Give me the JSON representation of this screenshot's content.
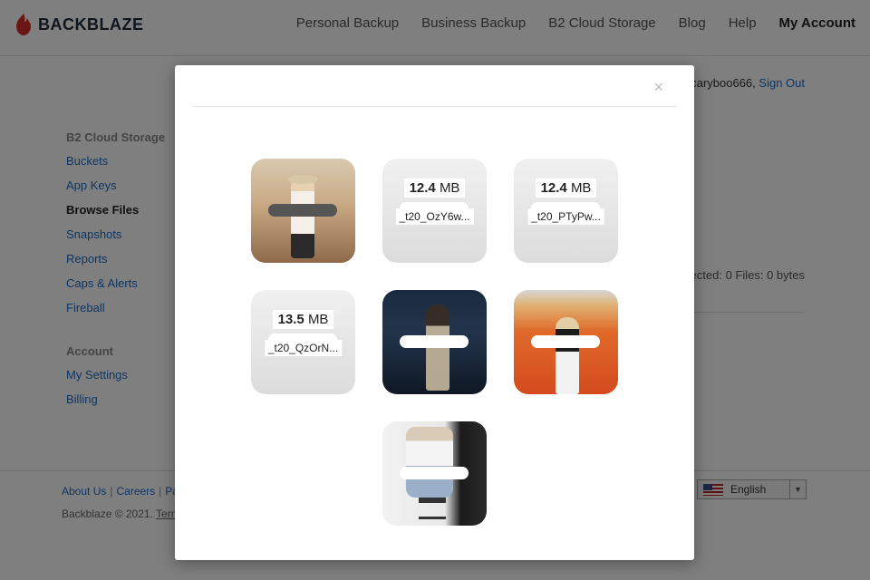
{
  "header": {
    "logo_text": "BACKBLAZE",
    "nav": [
      "Personal Backup",
      "Business Backup",
      "B2 Cloud Storage",
      "Blog",
      "Help",
      "My Account"
    ]
  },
  "user": {
    "name": "caryboo666,",
    "sign_out": "Sign Out"
  },
  "sidebar": {
    "group1_title": "B2 Cloud Storage",
    "items": [
      "Buckets",
      "App Keys",
      "Browse Files",
      "Snapshots",
      "Reports",
      "Caps & Alerts",
      "Fireball"
    ],
    "group2_title": "Account",
    "items2": [
      "My Settings",
      "Billing"
    ]
  },
  "stats_text": "ected: 0 Files: 0 bytes",
  "footer": {
    "links": [
      "About Us",
      "Careers",
      "Pa"
    ],
    "copyright": "Backblaze © 2021.",
    "terms": "Term",
    "language": "English"
  },
  "modal": {
    "close_label": "×",
    "tiles": [
      {
        "kind": "photo"
      },
      {
        "kind": "file",
        "size_value": "12.4",
        "size_unit": "MB",
        "name": "_t20_OzY6w..."
      },
      {
        "kind": "file",
        "size_value": "12.4",
        "size_unit": "MB",
        "name": "_t20_PTyPw..."
      },
      {
        "kind": "file",
        "size_value": "13.5",
        "size_unit": "MB",
        "name": "_t20_QzOrN..."
      },
      {
        "kind": "photo"
      },
      {
        "kind": "photo"
      },
      {
        "kind": "photo"
      }
    ]
  },
  "colors": {
    "link": "#1a6ccc",
    "brand_red": "#d92b2b",
    "overlay": "rgba(0,0,0,0.5)"
  }
}
